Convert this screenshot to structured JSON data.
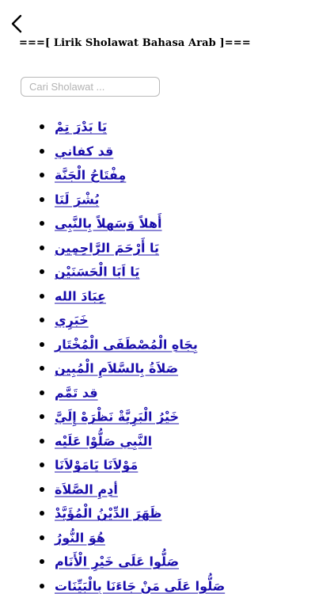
{
  "header": {
    "title": "===[ Lirik Sholawat Bahasa Arab ]==="
  },
  "search": {
    "placeholder": "Cari Sholawat ..."
  },
  "colors": {
    "link": "#1a0dab",
    "background": "#ffffff",
    "search_border": "#b9b9b9"
  },
  "icons": {
    "back": "chevron-left-icon"
  },
  "songs": [
    "يَا بَدْرَ تِمْ",
    "قد كفاني",
    "مِفْتَاحُ الْجَنَّة",
    "بُشْرَ لَنَا",
    "أَهلاً وَسَهلاً بِالنَّبِى",
    "يَا أَرْحَمَ الرَّاحِمِين",
    "يَا اَبَا الْحَسَنَيْن",
    "عِبَادَ الله",
    "خَبَرِي",
    "بِجَاهِ الْمُصْطَفَى الْمُخْتَار",
    "صَلاَةُ بِالسَّلاَمِ الْمُبِين",
    "قد تَمَّم",
    "خَيْرُ الْبَرِيَّةْ نَظْرَهْ إِلَيَّ",
    "النَّبِي صَلُّوْا عَلَيْه",
    "مَوْلاَنَا يَامَوْلاَنَا",
    "أدِمِ الصَّلاَة",
    "ظَهَرَ الدِّيْنُ الْمُؤَيَّدْ",
    "هُوَ النُّورُ",
    "صَلُّوا عَلَى خَيْرِ الْأَنَام",
    "صَلُّوا عَلَى مَنْ جَاءَنَا بِالْبَيِّنَات"
  ]
}
